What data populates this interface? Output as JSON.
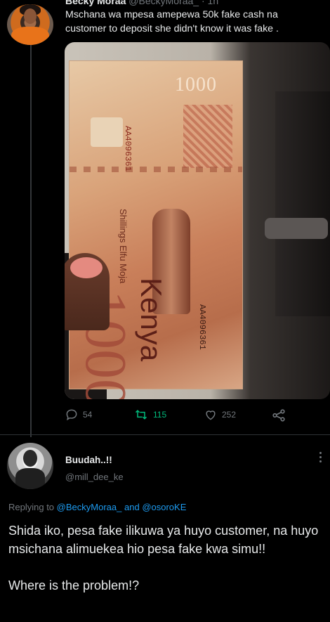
{
  "tweet": {
    "author_name": "Becky Moraa",
    "author_handle": "@BeckyMoraa_",
    "time": "· 1h",
    "text": "Mschana wa mpesa amepewa 50k fake cash na customer to deposit she didn't know it was fake .",
    "stats": {
      "replies": "54",
      "retweets": "115",
      "likes": "252"
    },
    "icons": {
      "reply": "reply-icon",
      "retweet": "retweet-icon",
      "like": "heart-icon",
      "share": "share-icon"
    },
    "banknote": {
      "value": "1000",
      "country": "Kenya",
      "serial": "AA4096361",
      "words": "Shillings Elfu Moja"
    }
  },
  "reply": {
    "author_name": "Buudah..!!",
    "author_handle": "@mill_dee_ke",
    "replying_prefix": "Replying to",
    "mention_1": "@BeckyMoraa_",
    "mention_joiner": "and",
    "mention_2": "@osoroKE",
    "text": "Shida iko, pesa fake ilikuwa ya huyo customer, na huyo msichana alimuekea hio pesa fake kwa simu!!\n\nWhere is the problem!?"
  },
  "colors": {
    "background": "#000000",
    "text": "#e7e9ea",
    "muted": "#71767b",
    "accent": "#1d9bf0",
    "retweet_active": "#00ba7c"
  }
}
